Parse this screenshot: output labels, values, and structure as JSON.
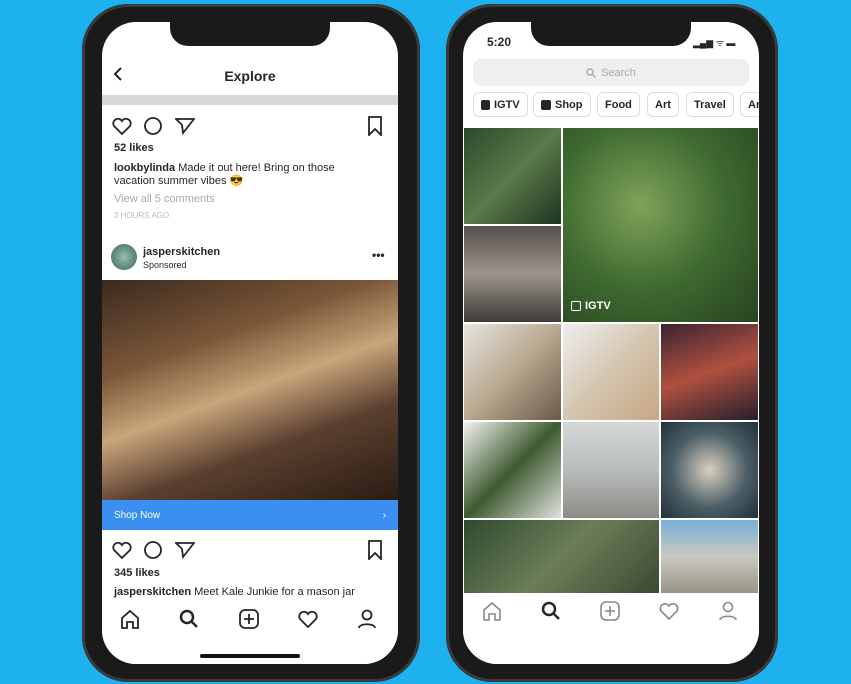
{
  "left": {
    "header": {
      "title": "Explore",
      "back_icon": "chevron-left-icon"
    },
    "post1": {
      "likes": "52 likes",
      "username": "lookbylinda",
      "caption": "Made it out here! Bring on those vacation summer vibes 😎",
      "comments": "View all 5 comments",
      "time": "3 HOURS AGO"
    },
    "post2": {
      "username": "jasperskitchen",
      "subtitle": "Sponsored",
      "cta": "Shop Now",
      "likes": "345 likes",
      "caption_user": "jasperskitchen",
      "caption": "Meet Kale Junkie for a mason jar"
    },
    "accent": "#3b8ff0"
  },
  "right": {
    "status": {
      "time": "5:20"
    },
    "search": {
      "placeholder": "Search"
    },
    "chips": [
      {
        "label": "IGTV"
      },
      {
        "label": "Shop"
      },
      {
        "label": "Food"
      },
      {
        "label": "Art"
      },
      {
        "label": "Travel"
      },
      {
        "label": "Ar"
      }
    ],
    "igtv_label": "IGTV"
  },
  "nav": [
    "home-icon",
    "search-icon",
    "add-icon",
    "heart-icon",
    "profile-icon"
  ],
  "background": "#1eb1ef"
}
